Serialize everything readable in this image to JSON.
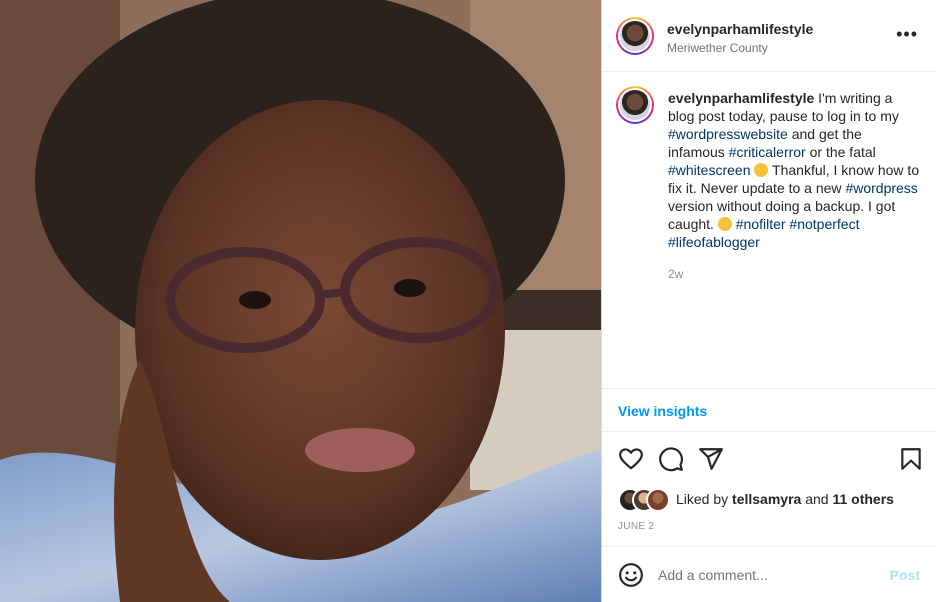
{
  "post": {
    "username": "evelynparhamlifestyle",
    "location": "Meriwether County",
    "more_icon": "more-horizontal-icon"
  },
  "caption": {
    "username": "evelynparhamlifestyle",
    "t1": " I'm writing a blog post today, pause to log in to my ",
    "tag1": "#wordpresswebsite",
    "t2": " and get the infamous ",
    "tag2": "#criticalerror",
    "t3": " or the fatal ",
    "tag3": "#whitescreen",
    "t4": " Thankful, I know how to fix it. Never update to a new ",
    "tag4": "#wordpress",
    "t5": " version without doing a backup. I got caught. ",
    "tag5": "#nofilter",
    "tag6": "#notperfect",
    "tag7": "#lifeofablogger",
    "time_ago": "2w"
  },
  "insights": {
    "label": "View insights",
    "color": "#0095f6"
  },
  "actions": {
    "like_icon": "heart-icon",
    "comment_icon": "comment-icon",
    "share_icon": "send-icon",
    "save_icon": "bookmark-icon"
  },
  "likes": {
    "prefix": "Liked by ",
    "user": "tellsamyra",
    "mid": " and ",
    "others": "11 others"
  },
  "date": "JUNE 2",
  "comment": {
    "placeholder": "Add a comment...",
    "post_label": "Post"
  }
}
